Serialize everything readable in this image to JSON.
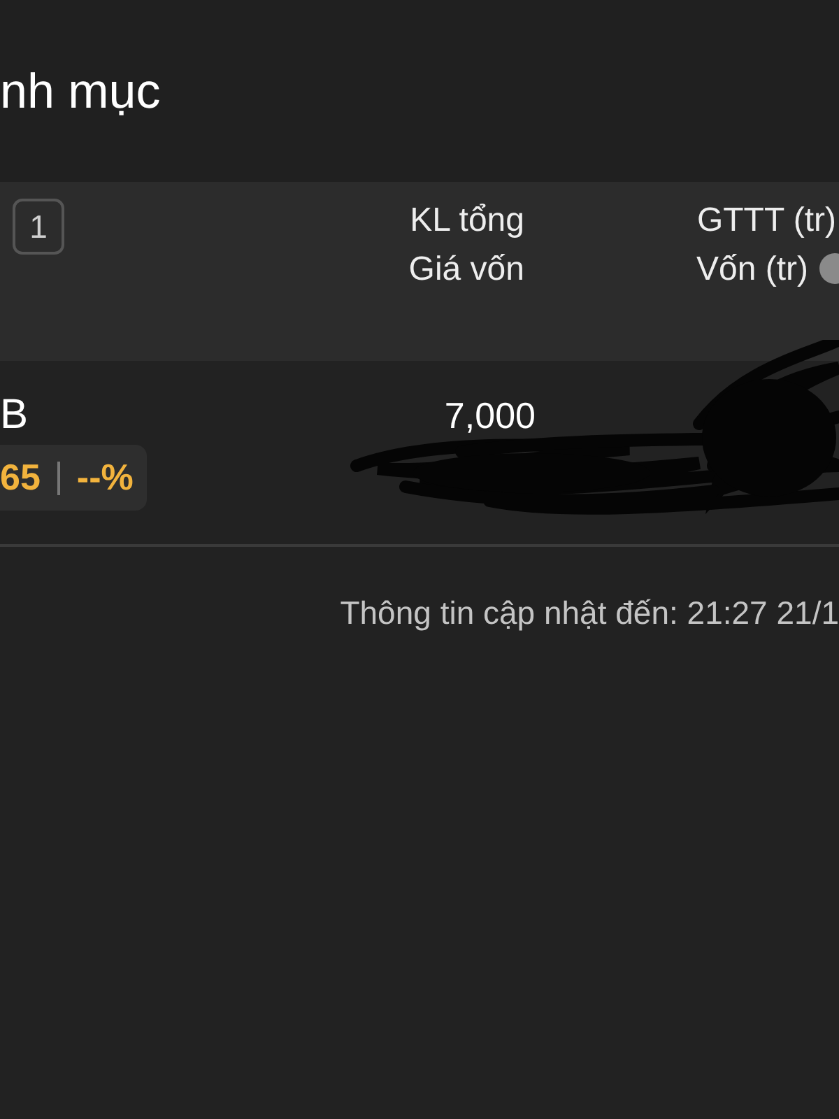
{
  "header": {
    "title": "nh mục"
  },
  "table": {
    "filter_count": "1",
    "columns": [
      {
        "line_1": "KL tổng",
        "line_2": "Giá vốn",
        "info": false
      },
      {
        "line_1": "GTTT (tr)",
        "line_2": "Vốn (tr)",
        "info": true
      }
    ],
    "rows": [
      {
        "symbol": "B",
        "price": "65",
        "change": "--%",
        "quantity": "7,000"
      }
    ]
  },
  "footer": {
    "updated": "Thông tin cập nhật đến: 21:27 21/1"
  }
}
